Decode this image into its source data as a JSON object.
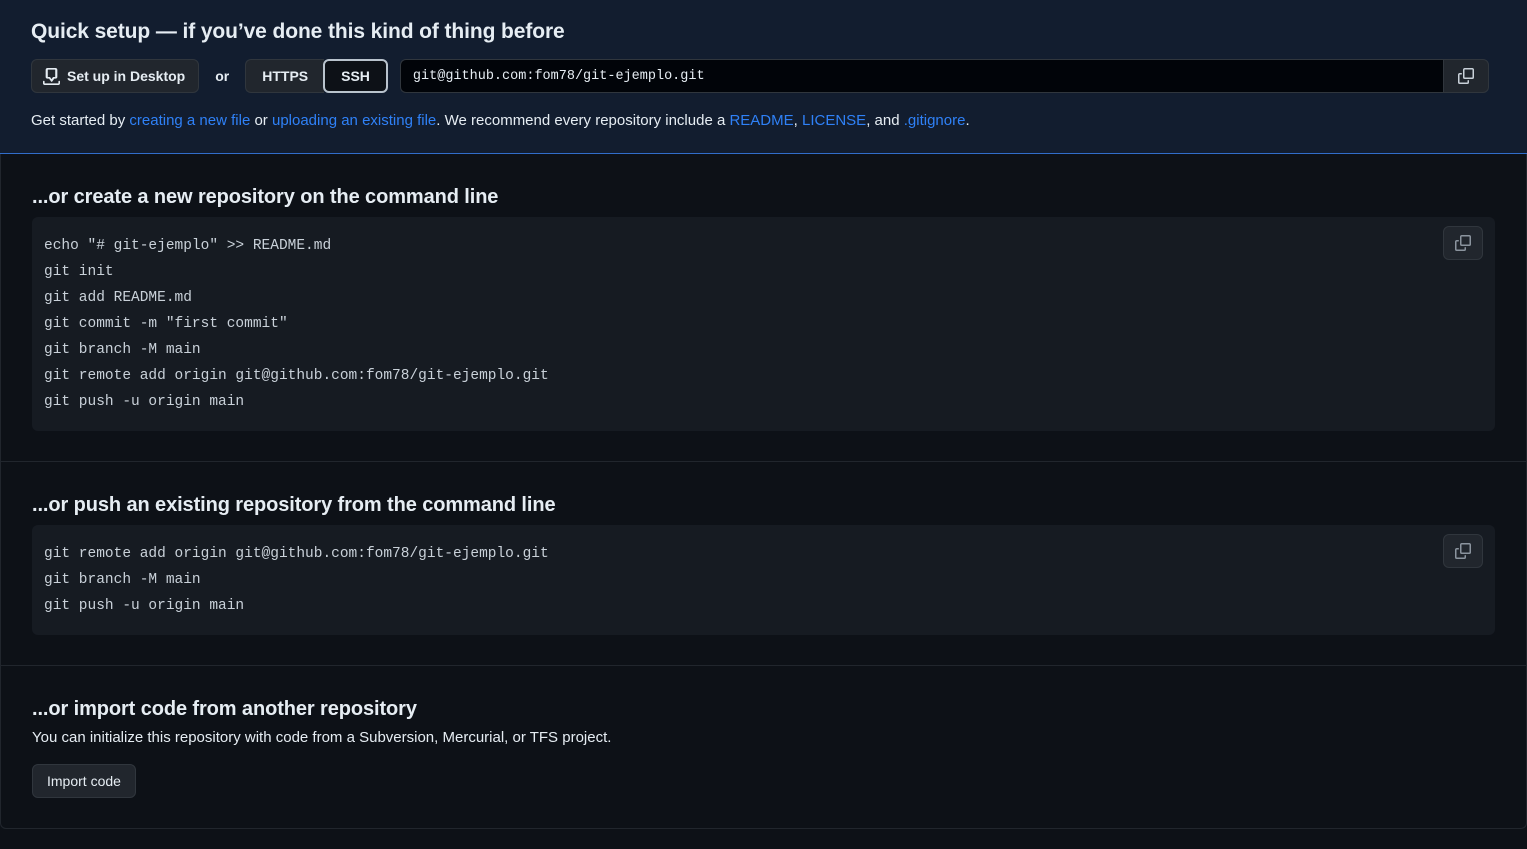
{
  "quick_setup": {
    "title": "Quick setup — if you’ve done this kind of thing before",
    "desktop_button": {
      "label": "Set up in Desktop",
      "icon": "desktop-download-icon"
    },
    "or_label": "or",
    "protocols": [
      {
        "label": "HTTPS",
        "selected": false
      },
      {
        "label": "SSH",
        "selected": true
      }
    ],
    "clone_url": "git@github.com:fom78/git-ejemplo.git",
    "copy_icon": "clipboard-icon",
    "get_started": {
      "prefix": "Get started by ",
      "link_new_file": "creating a new file",
      "mid_or": " or ",
      "link_upload": "uploading an existing file",
      "middle": ". We recommend every repository include a ",
      "link_readme": "README",
      "comma1": ", ",
      "link_license": "LICENSE",
      "and": ", and ",
      "link_gitignore": ".gitignore",
      "period": "."
    }
  },
  "sections": {
    "create_new": {
      "title": "...or create a new repository on the command line",
      "commands": [
        "echo \"# git-ejemplo\" >> README.md",
        "git init",
        "git add README.md",
        "git commit -m \"first commit\"",
        "git branch -M main",
        "git remote add origin git@github.com:fom78/git-ejemplo.git",
        "git push -u origin main"
      ],
      "copy_icon": "clipboard-icon"
    },
    "push_existing": {
      "title": "...or push an existing repository from the command line",
      "commands": [
        "git remote add origin git@github.com:fom78/git-ejemplo.git",
        "git branch -M main",
        "git push -u origin main"
      ],
      "copy_icon": "clipboard-icon"
    },
    "import_code": {
      "title": "...or import code from another repository",
      "description": "You can initialize this repository with code from a Subversion, Mercurial, or TFS project.",
      "button_label": "Import code"
    }
  },
  "colors": {
    "page_bg": "#0d1117",
    "banner_bg": "#121d2f",
    "banner_border": "#316dca",
    "link": "#2f81f7",
    "code_bg": "#161b22",
    "button_bg": "#21262d",
    "border": "#30363d",
    "divider": "#21262d",
    "text": "#e6edf3",
    "selected_border": "#b9c3cd"
  }
}
